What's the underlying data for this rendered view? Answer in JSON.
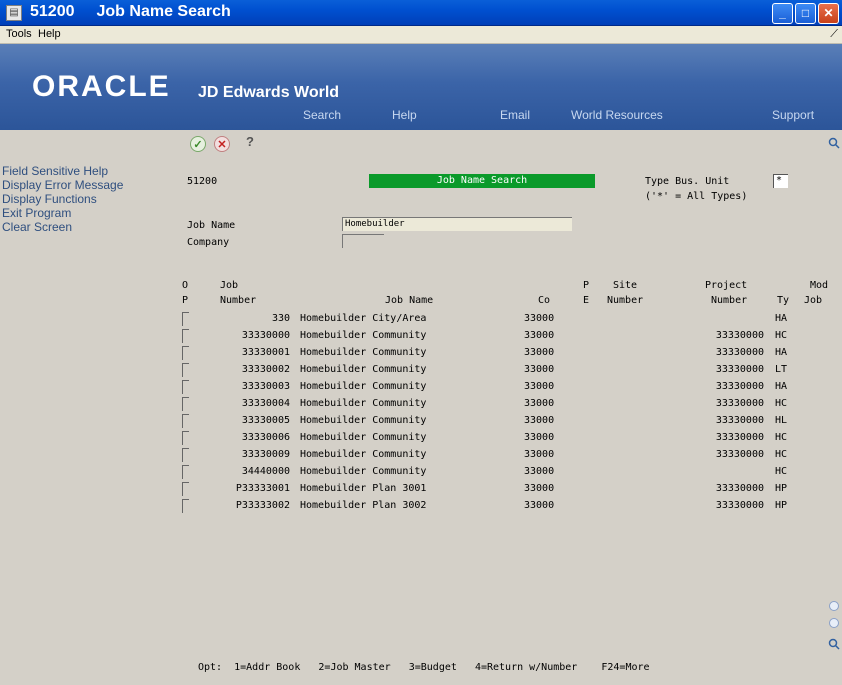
{
  "window": {
    "code": "51200",
    "title": "Job Name Search",
    "icon": "app-icon",
    "buttons": [
      "minimize-icon",
      "maximize-icon",
      "close-icon"
    ]
  },
  "menu": {
    "tools": "Tools",
    "help": "Help"
  },
  "banner": {
    "oracle": "ORACLE",
    "product": "JD Edwards World",
    "nav": {
      "search": "Search",
      "help": "Help",
      "email": "Email",
      "world_resources": "World Resources",
      "support": "Support"
    }
  },
  "sidebar": {
    "items": [
      {
        "label": "Field Sensitive Help"
      },
      {
        "label": "Display Error Message"
      },
      {
        "label": "Display Functions"
      },
      {
        "label": "Exit Program"
      },
      {
        "label": "Clear Screen"
      }
    ]
  },
  "toolbar": {
    "ok_icon": "check-icon",
    "cancel_icon": "x-icon",
    "help_glyph": "?"
  },
  "form": {
    "screen_id": "51200",
    "screen_title": "Job Name Search",
    "type_bu_label": "Type Bus. Unit",
    "type_bu_hint": "('*' = All Types)",
    "type_bu_value": "*",
    "job_name_label": "Job Name",
    "job_name_value": "Homebuilder",
    "company_label": "Company",
    "company_value": ""
  },
  "table": {
    "headers_top": {
      "op": "O",
      "job": "Job",
      "pe": "P",
      "site": "Site",
      "project": "Project",
      "mod": "Mod"
    },
    "headers_bottom": {
      "op": "P",
      "job": "Number",
      "name": "Job Name",
      "co": "Co",
      "pe": "E",
      "site": "Number",
      "project": "Number",
      "ty": "Ty",
      "mod": "Job"
    },
    "rows": [
      {
        "job": "330",
        "name": "Homebuilder City/Area",
        "co": "33000",
        "project": "",
        "ty": "HA"
      },
      {
        "job": "33330000",
        "name": "Homebuilder Community",
        "co": "33000",
        "project": "33330000",
        "ty": "HC"
      },
      {
        "job": "33330001",
        "name": "Homebuilder Community",
        "co": "33000",
        "project": "33330000",
        "ty": "HA"
      },
      {
        "job": "33330002",
        "name": "Homebuilder Community",
        "co": "33000",
        "project": "33330000",
        "ty": "LT"
      },
      {
        "job": "33330003",
        "name": "Homebuilder Community",
        "co": "33000",
        "project": "33330000",
        "ty": "HA"
      },
      {
        "job": "33330004",
        "name": "Homebuilder Community",
        "co": "33000",
        "project": "33330000",
        "ty": "HC"
      },
      {
        "job": "33330005",
        "name": "Homebuilder Community",
        "co": "33000",
        "project": "33330000",
        "ty": "HL"
      },
      {
        "job": "33330006",
        "name": "Homebuilder Community",
        "co": "33000",
        "project": "33330000",
        "ty": "HC"
      },
      {
        "job": "33330009",
        "name": "Homebuilder Community",
        "co": "33000",
        "project": "33330000",
        "ty": "HC"
      },
      {
        "job": "34440000",
        "name": "Homebuilder Community",
        "co": "33000",
        "project": "",
        "ty": "HC"
      },
      {
        "job": "P33333001",
        "name": "Homebuilder Plan 3001",
        "co": "33000",
        "project": "33330000",
        "ty": "HP"
      },
      {
        "job": "P33333002",
        "name": "Homebuilder Plan 3002",
        "co": "33000",
        "project": "33330000",
        "ty": "HP"
      }
    ]
  },
  "footer": {
    "options": "Opt:  1=Addr Book   2=Job Master   3=Budget   4=Return w/Number    F24=More"
  }
}
